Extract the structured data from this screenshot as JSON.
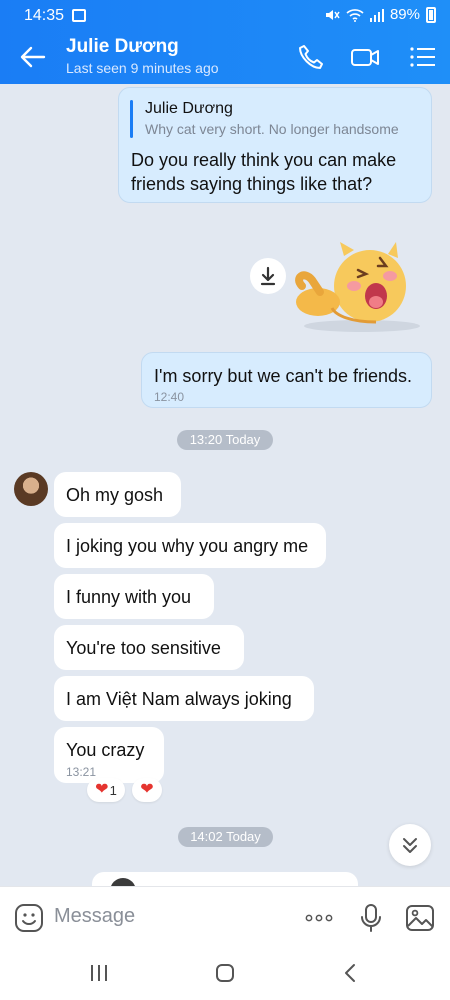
{
  "status": {
    "time": "14:35",
    "battery": "89%"
  },
  "header": {
    "name": "Julie Dương",
    "last_seen": "Last seen 9 minutes ago"
  },
  "messages": {
    "quote": {
      "author": "Julie Dương",
      "quoted": "Why cat very short. No longer handsome",
      "line1": "Do you really think you can make",
      "line2": "friends saying things like that?"
    },
    "sorry": {
      "text": "I'm sorry but we can't be friends.",
      "time": "12:40"
    },
    "date1": "13:20 Today",
    "in1": "Oh my gosh",
    "in2": "I joking you why you angry me",
    "in3": "I funny with you",
    "in4": "You're too sensitive",
    "in5": "I am Việt Nam always joking",
    "in6": {
      "text": "You crazy",
      "time": "13:21"
    },
    "reaction_count": "1",
    "date2": "14:02 Today"
  },
  "input": {
    "placeholder": "Message"
  },
  "colors": {
    "header": "#1a7df5",
    "outgoing": "#d7ecfe",
    "incoming": "#ffffff",
    "background": "#e2e8f1"
  },
  "icons": [
    "back-arrow-icon",
    "phone-icon",
    "video-call-icon",
    "menu-list-icon",
    "download-icon",
    "chevron-down-icon",
    "sticker-smile-icon",
    "more-icon",
    "microphone-icon",
    "image-icon",
    "recent-apps-icon",
    "home-icon",
    "back-nav-icon"
  ]
}
